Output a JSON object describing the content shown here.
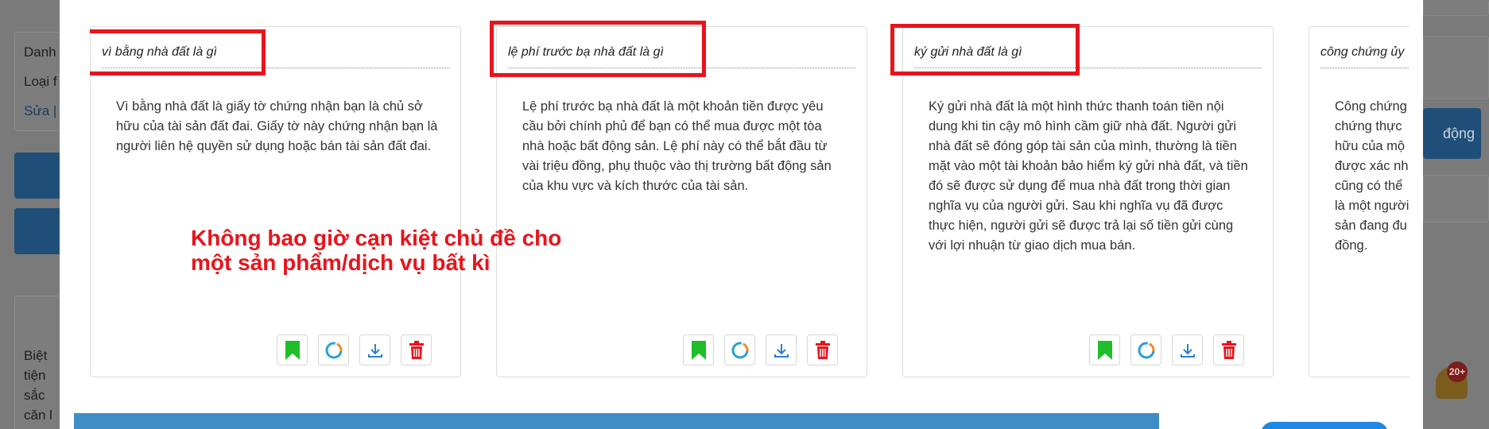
{
  "background": {
    "left_texts": [
      "Danh",
      "Loại f",
      "Sửa |"
    ],
    "left_snippet": [
      "Biệt",
      "tiện",
      "sắc",
      "căn l"
    ],
    "right_button": "động",
    "notification_count": "20+"
  },
  "cards": [
    {
      "title": "vì bằng nhà đất là gì",
      "body": " Vì bằng nhà đất là giấy tờ chứng nhận bạn là chủ sở hữu của tài sản đất đai. Giấy tờ này chứng nhận bạn là người liên hệ quyền sử dụng hoặc bán tài sản đất đai."
    },
    {
      "title": "lệ phí trước bạ nhà đất là gì",
      "body": "Lệ phí trước bạ nhà đất là một khoản tiền được yêu cầu bởi chính phủ để bạn có thể mua được một tòa nhà hoặc bất động sản. Lệ phí này có thể bắt đầu từ vài triệu đồng, phụ thuộc vào thị trường bất động sản của khu vực và kích thước của tài sản."
    },
    {
      "title": "ký gửi nhà đất là gì",
      "body": "Ký gửi nhà đất là một hình thức thanh toán tiền nội dung khi tin cậy mô hình cầm giữ nhà đất. Người gửi nhà đất sẽ đóng góp tài sản của mình, thường là tiền mặt vào một tài khoản bảo hiểm ký gửi nhà đất, và tiền đó sẽ được sử dụng để mua nhà đất trong thời gian nghĩa vụ của người gửi. Sau khi nghĩa vụ đã được thực hiện, người gửi sẽ được trả lại số tiền gửi cùng với lợi nhuận từ giao dịch mua bán."
    },
    {
      "title": "công chứng ủy",
      "body": "Công chứng chứng thực hữu của mộ được xác nh cũng có thể là một người sản đang đu đồng."
    }
  ],
  "annotation": {
    "line1": "Không bao giờ cạn kiệt chủ đề cho",
    "line2": "một sản phẩm/dịch vụ bất kì"
  },
  "colors": {
    "highlight": "#e8141c",
    "bookmark": "#1fbf2a",
    "refresh": "#2a9fd6",
    "download": "#2a7fd6",
    "delete": "#e8141c",
    "bottom_bar": "#3e8dc6"
  }
}
